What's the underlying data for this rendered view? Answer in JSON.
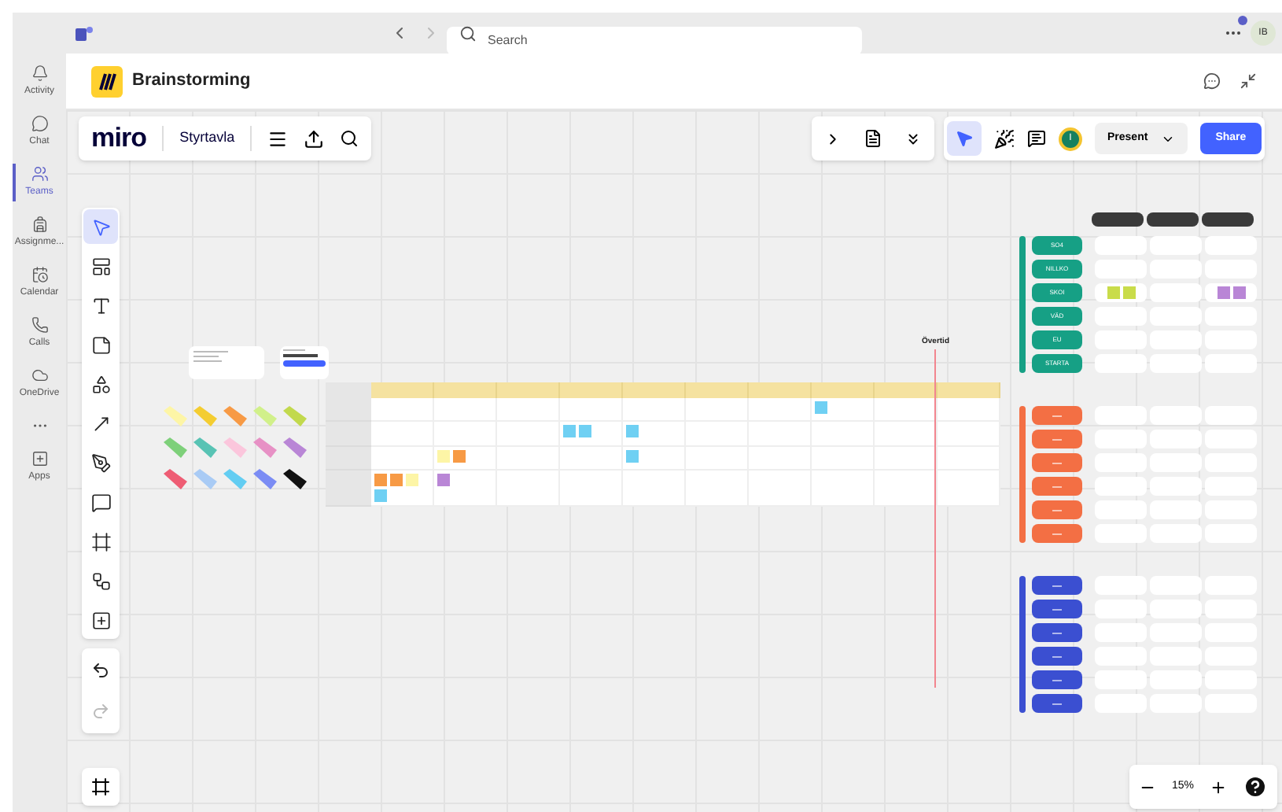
{
  "top_bar": {
    "search": {
      "placeholder": "Search"
    },
    "avatar": {
      "initials": "IB"
    }
  },
  "rail": [
    {
      "label": "Activity",
      "kind": "bell",
      "selected": false
    },
    {
      "label": "Chat",
      "kind": "chat",
      "selected": false
    },
    {
      "label": "Teams",
      "kind": "teams",
      "selected": true
    },
    {
      "label": "Assignme...",
      "kind": "bag",
      "selected": false
    },
    {
      "label": "Calendar",
      "kind": "calendar",
      "selected": false
    },
    {
      "label": "Calls",
      "kind": "phone",
      "selected": false
    },
    {
      "label": "OneDrive",
      "kind": "cloud",
      "selected": false
    },
    {
      "kind": "more",
      "selected": false
    },
    {
      "label": "Apps",
      "kind": "apps",
      "selected": false
    }
  ],
  "header": {
    "title": "Brainstorming"
  },
  "board_bar": {
    "logo": "miro",
    "board_name": "Styrtavla"
  },
  "right_bar": {
    "avatar": "I",
    "present": "Present",
    "share": "Share"
  },
  "tools": [
    {
      "kind": "select",
      "selected": true
    },
    {
      "kind": "template",
      "selected": false
    },
    {
      "kind": "text",
      "selected": false
    },
    {
      "kind": "sticky",
      "selected": false
    },
    {
      "kind": "shapes",
      "selected": false
    },
    {
      "kind": "arrow",
      "selected": false
    },
    {
      "kind": "pen",
      "selected": false
    },
    {
      "kind": "comment",
      "selected": false
    },
    {
      "kind": "frame",
      "selected": false
    },
    {
      "kind": "flow",
      "selected": false
    },
    {
      "kind": "add",
      "selected": false
    }
  ],
  "history": [
    {
      "kind": "undo",
      "disabled": false
    },
    {
      "kind": "redo",
      "disabled": true
    }
  ],
  "palette": [
    {
      "color": "#fdf5a6"
    },
    {
      "color": "#f4cd31"
    },
    {
      "color": "#f79a45"
    },
    {
      "color": "#d1f08a"
    },
    {
      "color": "#c2d94d"
    },
    {
      "color": "#7ed07a"
    },
    {
      "color": "#58c3b4"
    },
    {
      "color": "#fbc6dc"
    },
    {
      "color": "#e791c5"
    },
    {
      "color": "#b986d6"
    },
    {
      "color": "#ee5d74"
    },
    {
      "color": "#a9cbf5"
    },
    {
      "color": "#63cdf2"
    },
    {
      "color": "#7b8cf4"
    },
    {
      "color": "#111111"
    }
  ],
  "timeline": {
    "rows": [
      {
        "cells": [
          {},
          {},
          {},
          {},
          {},
          {},
          {},
          {
            "notes": [
              {
                "color": "#6fd0f3"
              }
            ]
          },
          {},
          {}
        ]
      },
      {
        "cells": [
          {},
          {},
          {},
          {
            "notes": [
              {
                "color": "#6fd0f3"
              },
              {
                "color": "#6fd0f3"
              }
            ]
          },
          {
            "notes": [
              {
                "color": "#6fd0f3"
              }
            ]
          },
          {},
          {},
          {},
          {},
          {}
        ]
      },
      {
        "cells": [
          {},
          {
            "notes": [
              {
                "color": "#fdf5a6"
              },
              {
                "color": "#f79a45"
              }
            ]
          },
          {},
          {},
          {
            "notes": [
              {
                "color": "#6fd0f3"
              }
            ]
          },
          {},
          {},
          {},
          {},
          {}
        ]
      },
      {
        "cells": [
          {
            "notes": [
              {
                "color": "#f79a45"
              },
              {
                "color": "#f79a45"
              },
              {
                "color": "#fdf5a6"
              },
              {
                "color": "#6fd0f3"
              }
            ]
          },
          {
            "notes": [
              {
                "color": "#b986d6"
              }
            ]
          },
          {},
          {},
          {},
          {},
          {},
          {},
          {},
          {}
        ]
      }
    ]
  },
  "marker": {
    "label": "Övertid"
  },
  "groups": [
    {
      "color": "#16a085",
      "rows": [
        {
          "label": "SO4",
          "cells": [
            {},
            {},
            {}
          ]
        },
        {
          "label": "NILLKO",
          "cells": [
            {},
            {},
            {}
          ]
        },
        {
          "label": "SKOI",
          "cells": [
            {
              "notes": [
                {
                  "color": "#c9dc4a"
                },
                {
                  "color": "#c9dc4a"
                }
              ]
            },
            {},
            {
              "notes": [
                {
                  "color": "#b986d6"
                },
                {
                  "color": "#b986d6"
                }
              ]
            }
          ]
        },
        {
          "label": "VÄD",
          "cells": [
            {},
            {},
            {}
          ]
        },
        {
          "label": "EU",
          "cells": [
            {},
            {},
            {}
          ]
        },
        {
          "label": "STARTA",
          "cells": [
            {},
            {},
            {}
          ]
        }
      ]
    },
    {
      "color": "#f36f44",
      "rows": [
        {
          "cells": [
            {},
            {},
            {}
          ]
        },
        {
          "cells": [
            {},
            {},
            {}
          ]
        },
        {
          "cells": [
            {},
            {},
            {}
          ]
        },
        {
          "cells": [
            {},
            {},
            {}
          ]
        },
        {
          "cells": [
            {},
            {},
            {}
          ]
        },
        {
          "cells": [
            {},
            {},
            {}
          ]
        }
      ]
    },
    {
      "color": "#3b4fd1",
      "rows": [
        {
          "cells": [
            {},
            {},
            {}
          ]
        },
        {
          "cells": [
            {},
            {},
            {}
          ]
        },
        {
          "cells": [
            {},
            {},
            {}
          ]
        },
        {
          "cells": [
            {},
            {},
            {}
          ]
        },
        {
          "cells": [
            {},
            {},
            {}
          ]
        },
        {
          "cells": [
            {},
            {},
            {}
          ]
        }
      ]
    }
  ],
  "zoom": {
    "value": "15%"
  }
}
